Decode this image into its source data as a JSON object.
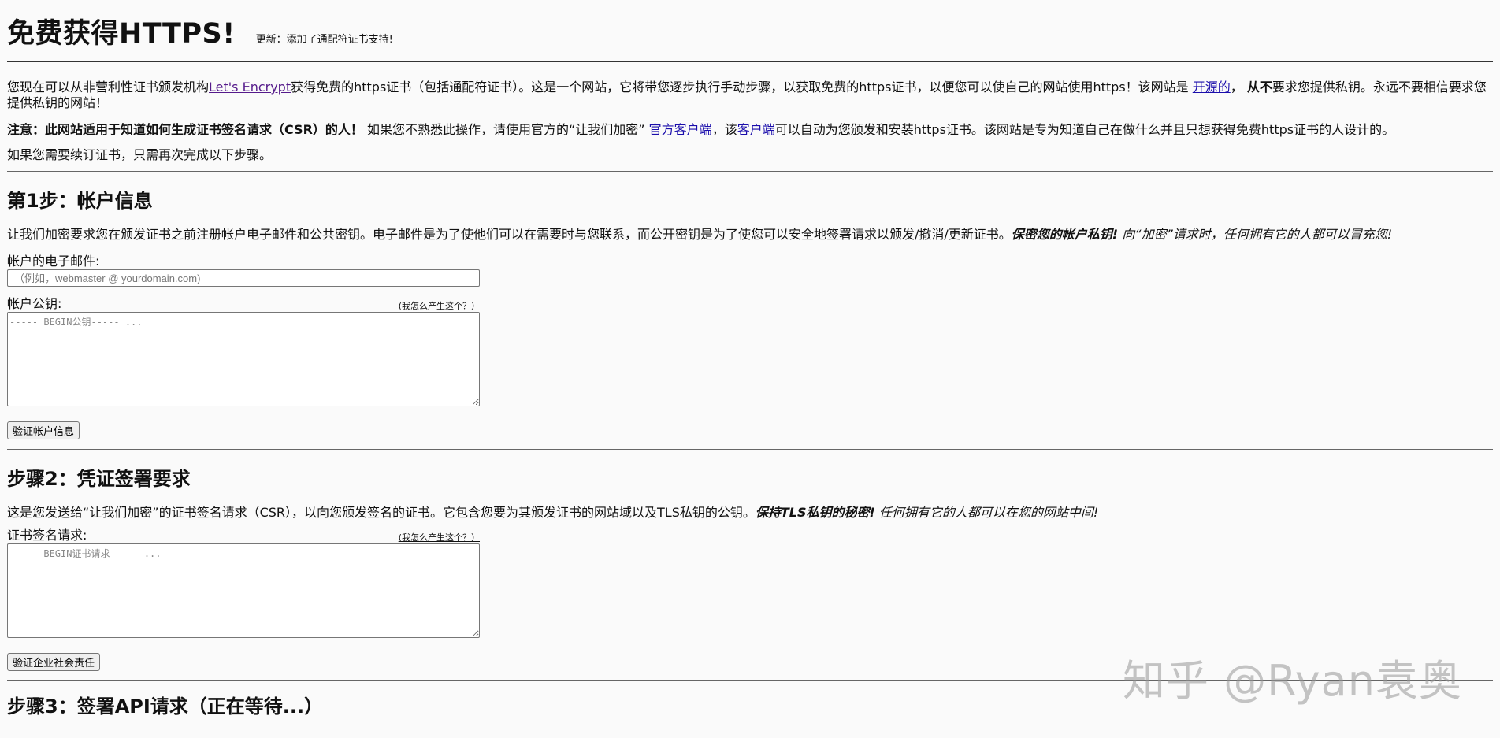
{
  "header": {
    "title": "免费获得HTTPS!",
    "update": "更新：添加了通配符证书支持!"
  },
  "intro": {
    "t1": "您现在可以从非营利性证书颁发机构",
    "link_lets_encrypt": "Let's Encrypt",
    "t2": "获得免费的https证书（包括通配符证书）。这是一个网站，它将带您逐步执行手动步骤，以获取免费的https证书，以便您可以使自己的网站使用https！该网站是",
    "link_open_source": "开源的",
    "t3": "，",
    "bold_never": "从不",
    "t4": "要求您提供私钥。永远不要相信要求您提供私钥的网站！"
  },
  "note": {
    "bold": "注意：此网站适用于知道如何生成证书签名请求（CSR）的人！",
    "t1": "如果您不熟悉此操作，请使用官方的“让我们加密”",
    "link_official_client": "官方客户端",
    "t2": "，该",
    "link_client": "客户端",
    "t3": "可以自动为您颁发和安装https证书。该网站是专为知道自己在做什么并且只想获得免费https证书的人设计的。"
  },
  "renew": "如果您需要续订证书，只需再次完成以下步骤。",
  "step1": {
    "title": "第1步：帐户信息",
    "desc": "让我们加密要求您在颁发证书之前注册帐户电子邮件和公共密钥。电子邮件是为了使他们可以在需要时与您联系，而公开密钥是为了使您可以安全地签署请求以颁发/撤消/更新证书。",
    "desc_bold_italic": "保密您的帐户私钥!",
    "desc_italic": "向“加密”请求时，任何拥有它的人都可以冒充您!",
    "email_label": "帐户的电子邮件:",
    "email_placeholder": "（例如，webmaster @ yourdomain.com)",
    "pubkey_label": "帐户公钥:",
    "how_link": "(我怎么产生这个？）",
    "pubkey_placeholder": "----- BEGIN公钥----- ...",
    "button": "验证帐户信息"
  },
  "step2": {
    "title": "步骤2：凭证签署要求",
    "desc": "这是您发送给“让我们加密”的证书签名请求（CSR），以向您颁发签名的证书。它包含您要为其颁发证书的网站域以及TLS私钥的公钥。",
    "desc_bold_italic": "保持TLS私钥的秘密!",
    "desc_italic": "任何拥有它的人都可以在您的网站中间!",
    "csr_label": "证书签名请求:",
    "how_link": "(我怎么产生这个？）",
    "csr_placeholder": "----- BEGIN证书请求----- ...",
    "button": "验证企业社会责任"
  },
  "step3": {
    "title": "步骤3：签署API请求（正在等待...）"
  },
  "watermark": "知乎 @Ryan袁奥"
}
